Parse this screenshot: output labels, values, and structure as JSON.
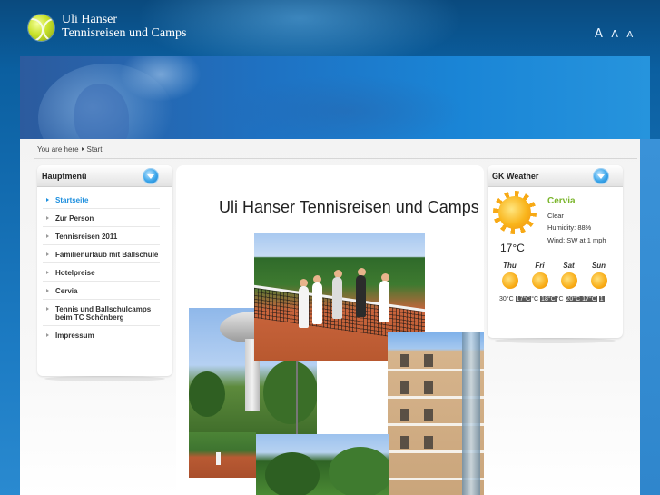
{
  "header": {
    "title_line1": "Uli Hanser",
    "title_line2": "Tennisreisen und Camps",
    "font_sizer": [
      "A",
      "A",
      "A"
    ]
  },
  "breadcrumb": {
    "prefix": "You are here",
    "current": "Start"
  },
  "menu": {
    "title": "Hauptmenü",
    "items": [
      {
        "label": "Startseite",
        "active": true
      },
      {
        "label": "Zur Person"
      },
      {
        "label": "Tennisreisen 2011"
      },
      {
        "label": "Familienurlaub mit Ballschule"
      },
      {
        "label": "Hotelpreise"
      },
      {
        "label": "Cervia"
      },
      {
        "label": "Tennis und Ballschulcamps beim TC Schönberg"
      },
      {
        "label": "Impressum"
      }
    ]
  },
  "content": {
    "title": "Uli Hanser Tennisreisen und Camps"
  },
  "weather": {
    "title": "GK Weather",
    "city": "Cervia",
    "condition": "Clear",
    "humidity": "Humidity: 88%",
    "wind": "Wind: SW at 1 mph",
    "current_temp": "17°C",
    "current_icon": "sun-icon",
    "forecast": [
      {
        "day": "Thu",
        "icon": "sun-icon"
      },
      {
        "day": "Fri",
        "icon": "sun-icon"
      },
      {
        "day": "Sat",
        "icon": "sun-icon"
      },
      {
        "day": "Sun",
        "icon": "sun-icon"
      }
    ],
    "forecast_temps": [
      "30°C",
      "17°C",
      "°C",
      "18°C",
      "°C",
      "20°C",
      "17°C",
      "1"
    ]
  },
  "colors": {
    "accent": "#1b8ede",
    "city_green": "#7ab52a",
    "header_blue": "#0b5fa0"
  }
}
